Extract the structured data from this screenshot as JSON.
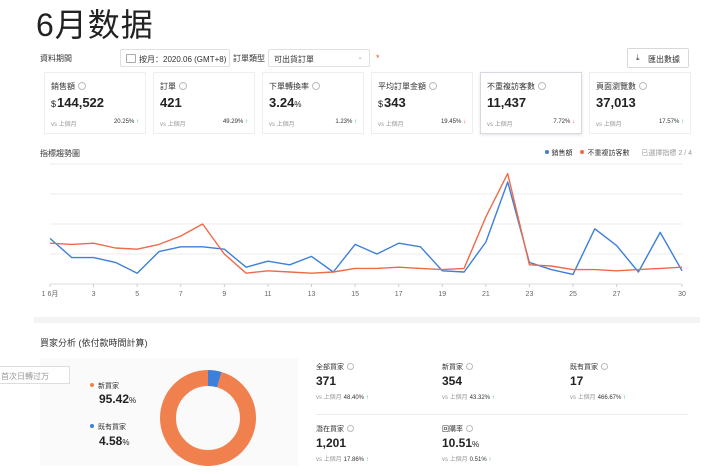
{
  "page": {
    "title": "6月数据"
  },
  "filters": {
    "period_label": "資料期間",
    "period_value": "按月：2020.06 (GMT+8)",
    "order_type_label": "訂單類型",
    "order_type_value": "可出貨訂單",
    "required_mark": "*",
    "export_icon": "download-icon",
    "export_label": "匯出數據"
  },
  "cards": [
    {
      "title": "銷售額",
      "currency": "$",
      "value": "144,522",
      "unit": "",
      "vs": "vs 上個月",
      "change": "20.25%",
      "dir": "up"
    },
    {
      "title": "訂單",
      "currency": "",
      "value": "421",
      "unit": "",
      "vs": "vs 上個月",
      "change": "49.29%",
      "dir": "up"
    },
    {
      "title": "下單轉換率",
      "currency": "",
      "value": "3.24",
      "unit": "%",
      "vs": "vs 上個月",
      "change": "1.23%",
      "dir": "up"
    },
    {
      "title": "平均訂單金額",
      "currency": "$",
      "value": "343",
      "unit": "",
      "vs": "vs 上個月",
      "change": "19.45%",
      "dir": "down"
    },
    {
      "title": "不重複訪客數",
      "currency": "",
      "value": "11,437",
      "unit": "",
      "vs": "vs 上個月",
      "change": "7.72%",
      "dir": "down"
    },
    {
      "title": "頁面瀏覽數",
      "currency": "",
      "value": "37,013",
      "unit": "",
      "vs": "vs 上個月",
      "change": "17.57%",
      "dir": "up"
    }
  ],
  "trend": {
    "title": "指標趨勢圖",
    "selected_count": "已選擇指標 2 / 4"
  },
  "chart_data": {
    "type": "line",
    "x": [
      1,
      2,
      3,
      4,
      5,
      6,
      7,
      8,
      9,
      10,
      11,
      12,
      13,
      14,
      15,
      16,
      17,
      18,
      19,
      20,
      21,
      22,
      23,
      24,
      25,
      26,
      27,
      28,
      29,
      30
    ],
    "x_tick_labels": [
      "1 6月",
      "3",
      "5",
      "7",
      "9",
      "11",
      "13",
      "15",
      "17",
      "19",
      "21",
      "23",
      "25",
      "27",
      "30"
    ],
    "x_tick_positions": [
      1,
      3,
      5,
      7,
      9,
      11,
      13,
      15,
      17,
      19,
      21,
      23,
      25,
      27,
      30
    ],
    "series": [
      {
        "name": "銷售額",
        "color": "#3d7fd9",
        "values": [
          38,
          22,
          22,
          18,
          9,
          27,
          31,
          31,
          29,
          14,
          19,
          16,
          23,
          10,
          33,
          25,
          34,
          31,
          11,
          10,
          35,
          85,
          18,
          12,
          8,
          46,
          32,
          10,
          43,
          11
        ]
      },
      {
        "name": "不重複訪客數",
        "color": "#ee6a4a",
        "values": [
          34,
          33,
          34,
          30,
          29,
          33,
          40,
          50,
          25,
          9,
          11,
          10,
          9,
          10,
          13,
          13,
          14,
          13,
          12,
          13,
          56,
          92,
          16,
          15,
          12,
          12,
          11,
          12,
          13,
          14
        ]
      }
    ],
    "ylim": [
      0,
      100
    ],
    "grid": true,
    "legend": "top-right"
  },
  "buyers": {
    "title": "買家分析 (依付款時間計算)",
    "tooltip": "首次日轉过万",
    "segments": [
      {
        "name": "新買家",
        "value": "95.42",
        "unit": "%",
        "color": "#f0814f"
      },
      {
        "name": "既有買家",
        "value": "4.58",
        "unit": "%",
        "color": "#3d7fd9"
      }
    ],
    "donut": {
      "new_share": 95.42,
      "existing_share": 4.58
    },
    "metrics": [
      {
        "title": "全部買家",
        "value": "371",
        "unit": "",
        "vs": "vs 上個月",
        "change": "48.40%",
        "dir": "up"
      },
      {
        "title": "新買家",
        "value": "354",
        "unit": "",
        "vs": "vs 上個月",
        "change": "43.32%",
        "dir": "up"
      },
      {
        "title": "既有買家",
        "value": "17",
        "unit": "",
        "vs": "vs 上個月",
        "change": "466.67%",
        "dir": "up"
      },
      {
        "title": "潛在買家",
        "value": "1,201",
        "unit": "",
        "vs": "vs 上個月",
        "change": "17.86%",
        "dir": "up"
      },
      {
        "title": "回購率",
        "value": "10.51",
        "unit": "%",
        "vs": "vs 上個月",
        "change": "0.51%",
        "dir": "up"
      }
    ]
  },
  "icons": {
    "up": "↑",
    "down": "↓",
    "info": "info-icon",
    "calendar": "calendar-icon"
  }
}
